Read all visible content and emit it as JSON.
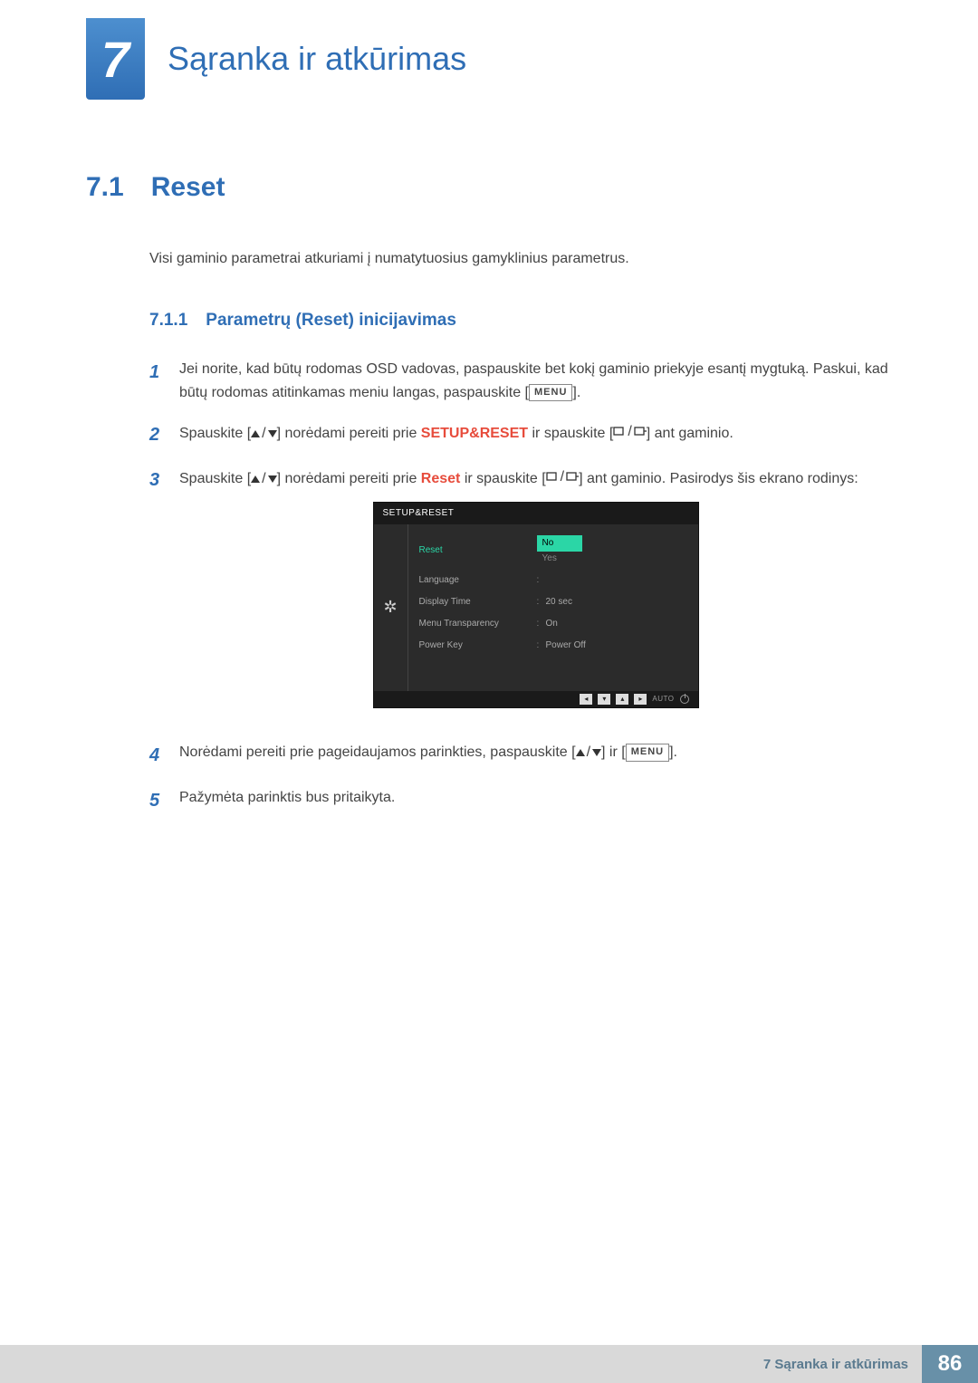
{
  "chapter": {
    "number": "7",
    "title": "Sąranka ir atkūrimas"
  },
  "section": {
    "number": "7.1",
    "title": "Reset",
    "intro": "Visi gaminio parametrai atkuriami į numatytuosius gamyklinius parametrus."
  },
  "subsection": {
    "number": "7.1.1",
    "title": "Parametrų (Reset) inicijavimas"
  },
  "steps": {
    "s1a": "Jei norite, kad būtų rodomas OSD vadovas, paspauskite bet kokį gaminio priekyje esantį mygtuką. Paskui, kad būtų rodomas atitinkamas meniu langas, paspauskite [",
    "s1b": "].",
    "s2a": "Spauskite [",
    "s2b": "] norėdami pereiti prie ",
    "s2c": "SETUP&RESET",
    "s2d": " ir spauskite [",
    "s2e": "] ant gaminio.",
    "s3a": "Spauskite [",
    "s3b": "] norėdami pereiti prie ",
    "s3c": "Reset",
    "s3d": " ir spauskite [",
    "s3e": "] ant gaminio. Pasirodys šis ekrano rodinys:",
    "s4a": "Norėdami pereiti prie pageidaujamos parinkties, paspauskite [",
    "s4b": "] ir [",
    "s4c": "].",
    "s5": "Pažymėta parinktis bus pritaikyta."
  },
  "menuLabel": "MENU",
  "osd": {
    "title": "SETUP&RESET",
    "rows": [
      {
        "label": "Reset",
        "value": "No",
        "value2": "Yes",
        "active": true
      },
      {
        "label": "Language",
        "value": ""
      },
      {
        "label": "Display Time",
        "value": "20 sec"
      },
      {
        "label": "Menu Transparency",
        "value": "On"
      },
      {
        "label": "Power Key",
        "value": "Power Off"
      }
    ],
    "bottombar_auto": "AUTO"
  },
  "footer": {
    "text": "7 Sąranka ir atkūrimas",
    "page": "86"
  }
}
